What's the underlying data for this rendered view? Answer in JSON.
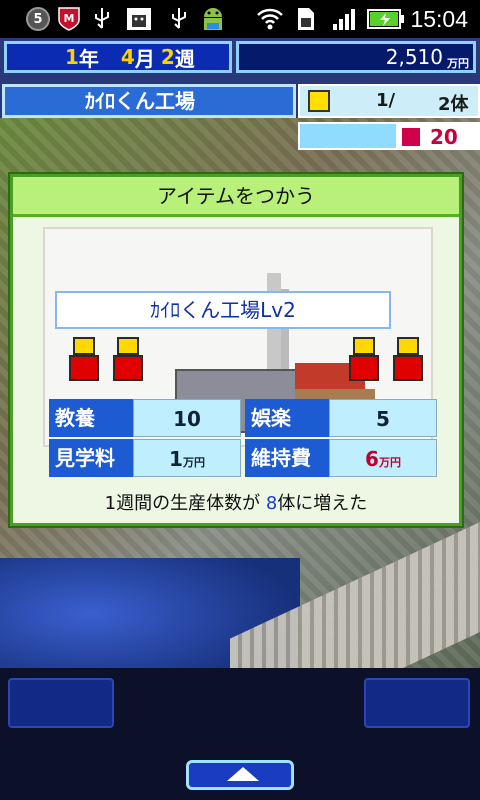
{
  "statusbar": {
    "notification_count": "5",
    "time": "15:04",
    "icons": [
      "notification-badge-icon",
      "mcafee-icon",
      "usb-icon",
      "android-debug-icon",
      "usb-icon",
      "android-icon",
      "wifi-icon",
      "sim-icon",
      "signal-icon",
      "battery-charging-icon"
    ]
  },
  "hud": {
    "date": {
      "year_num": "1",
      "year_unit": "年",
      "month_num": "4",
      "month_unit": "月",
      "week_num": "2",
      "week_unit": "週"
    },
    "money": {
      "value": "2,510",
      "unit": "万円"
    },
    "facility_name": "ｶｲﾛくん工場",
    "count": {
      "current": "1/",
      "total": "2体"
    },
    "save_count": "20"
  },
  "dialog": {
    "title": "アイテムをつかう",
    "facility_label": "ｶｲﾛくん工場Lv2",
    "stats": [
      {
        "label": "教養",
        "value": "10"
      },
      {
        "label": "娯楽",
        "value": "5"
      },
      {
        "label": "見学料",
        "value": "1",
        "unit": "万円"
      },
      {
        "label": "維持費",
        "value": "6",
        "unit": "万円"
      }
    ],
    "message_prefix": "1週間の生産体数が ",
    "message_highlight": "8",
    "message_suffix": "体に増えた"
  },
  "colors": {
    "accent_green": "#b8f07a",
    "stat_blue": "#1d5bd2",
    "highlight": "#1a3fd0"
  }
}
